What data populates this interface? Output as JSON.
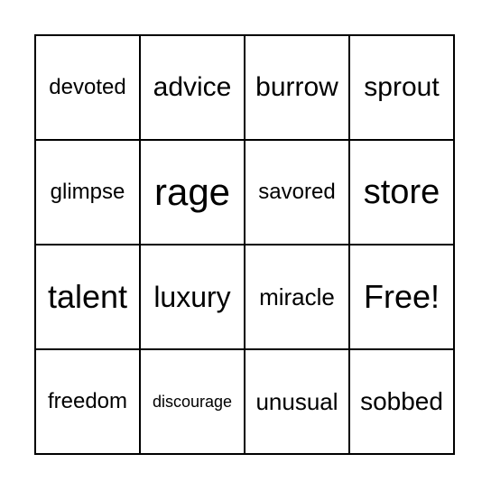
{
  "cells": [
    {
      "text": "devoted",
      "size": 24
    },
    {
      "text": "advice",
      "size": 30
    },
    {
      "text": "burrow",
      "size": 30
    },
    {
      "text": "sprout",
      "size": 30
    },
    {
      "text": "glimpse",
      "size": 24
    },
    {
      "text": "rage",
      "size": 42
    },
    {
      "text": "savored",
      "size": 24
    },
    {
      "text": "store",
      "size": 38
    },
    {
      "text": "talent",
      "size": 36
    },
    {
      "text": "luxury",
      "size": 32
    },
    {
      "text": "miracle",
      "size": 26
    },
    {
      "text": "Free!",
      "size": 36
    },
    {
      "text": "freedom",
      "size": 24
    },
    {
      "text": "discourage",
      "size": 18
    },
    {
      "text": "unusual",
      "size": 26
    },
    {
      "text": "sobbed",
      "size": 28
    }
  ]
}
